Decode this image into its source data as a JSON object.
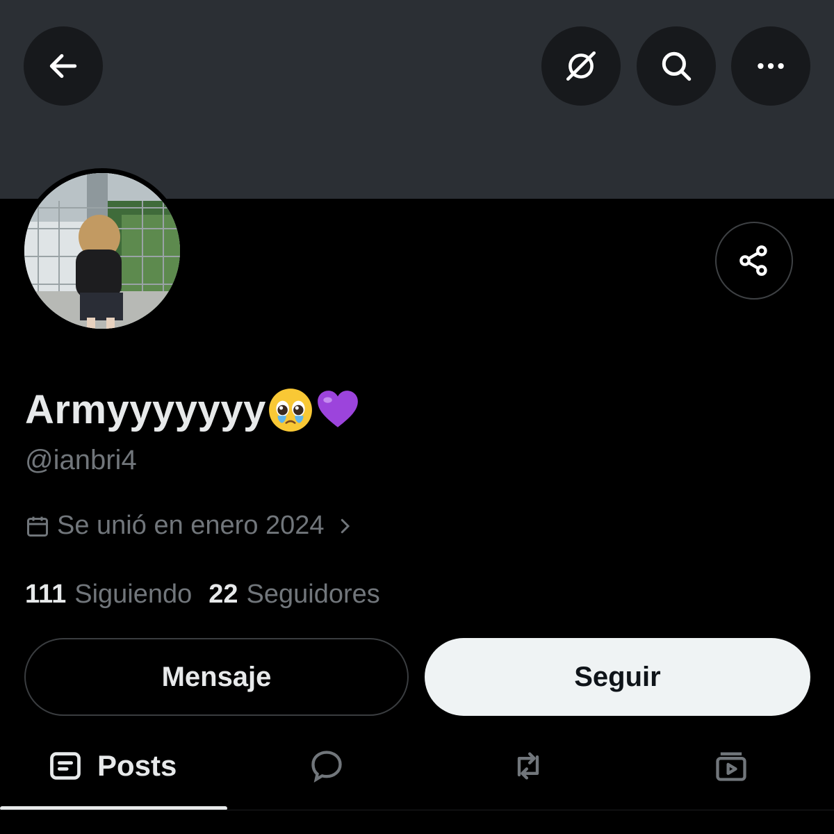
{
  "header": {
    "back_icon": "arrow-left-icon",
    "grok_icon": "grok-icon",
    "search_icon": "search-icon",
    "more_icon": "more-horizontal-icon"
  },
  "profile": {
    "display_name": "Armyyyyyyy",
    "name_emojis": [
      "pleading-face-emoji",
      "purple-heart-emoji"
    ],
    "handle": "@ianbri4",
    "joined": "Se unió en enero 2024",
    "following_count": "111",
    "following_label": "Siguiendo",
    "followers_count": "22",
    "followers_label": "Seguidores"
  },
  "actions": {
    "message_label": "Mensaje",
    "follow_label": "Seguir",
    "share_icon": "share-icon"
  },
  "tabs": [
    {
      "label": "Posts",
      "icon": "posts-icon",
      "active": true
    },
    {
      "label": "",
      "icon": "replies-icon",
      "active": false
    },
    {
      "label": "",
      "icon": "repost-icon",
      "active": false
    },
    {
      "label": "",
      "icon": "media-icon",
      "active": false
    }
  ],
  "colors": {
    "background": "#000000",
    "banner": "#2b2f34",
    "text_primary": "#e7e9ea",
    "text_secondary": "#71767b",
    "follow_button": "#eff3f4"
  }
}
